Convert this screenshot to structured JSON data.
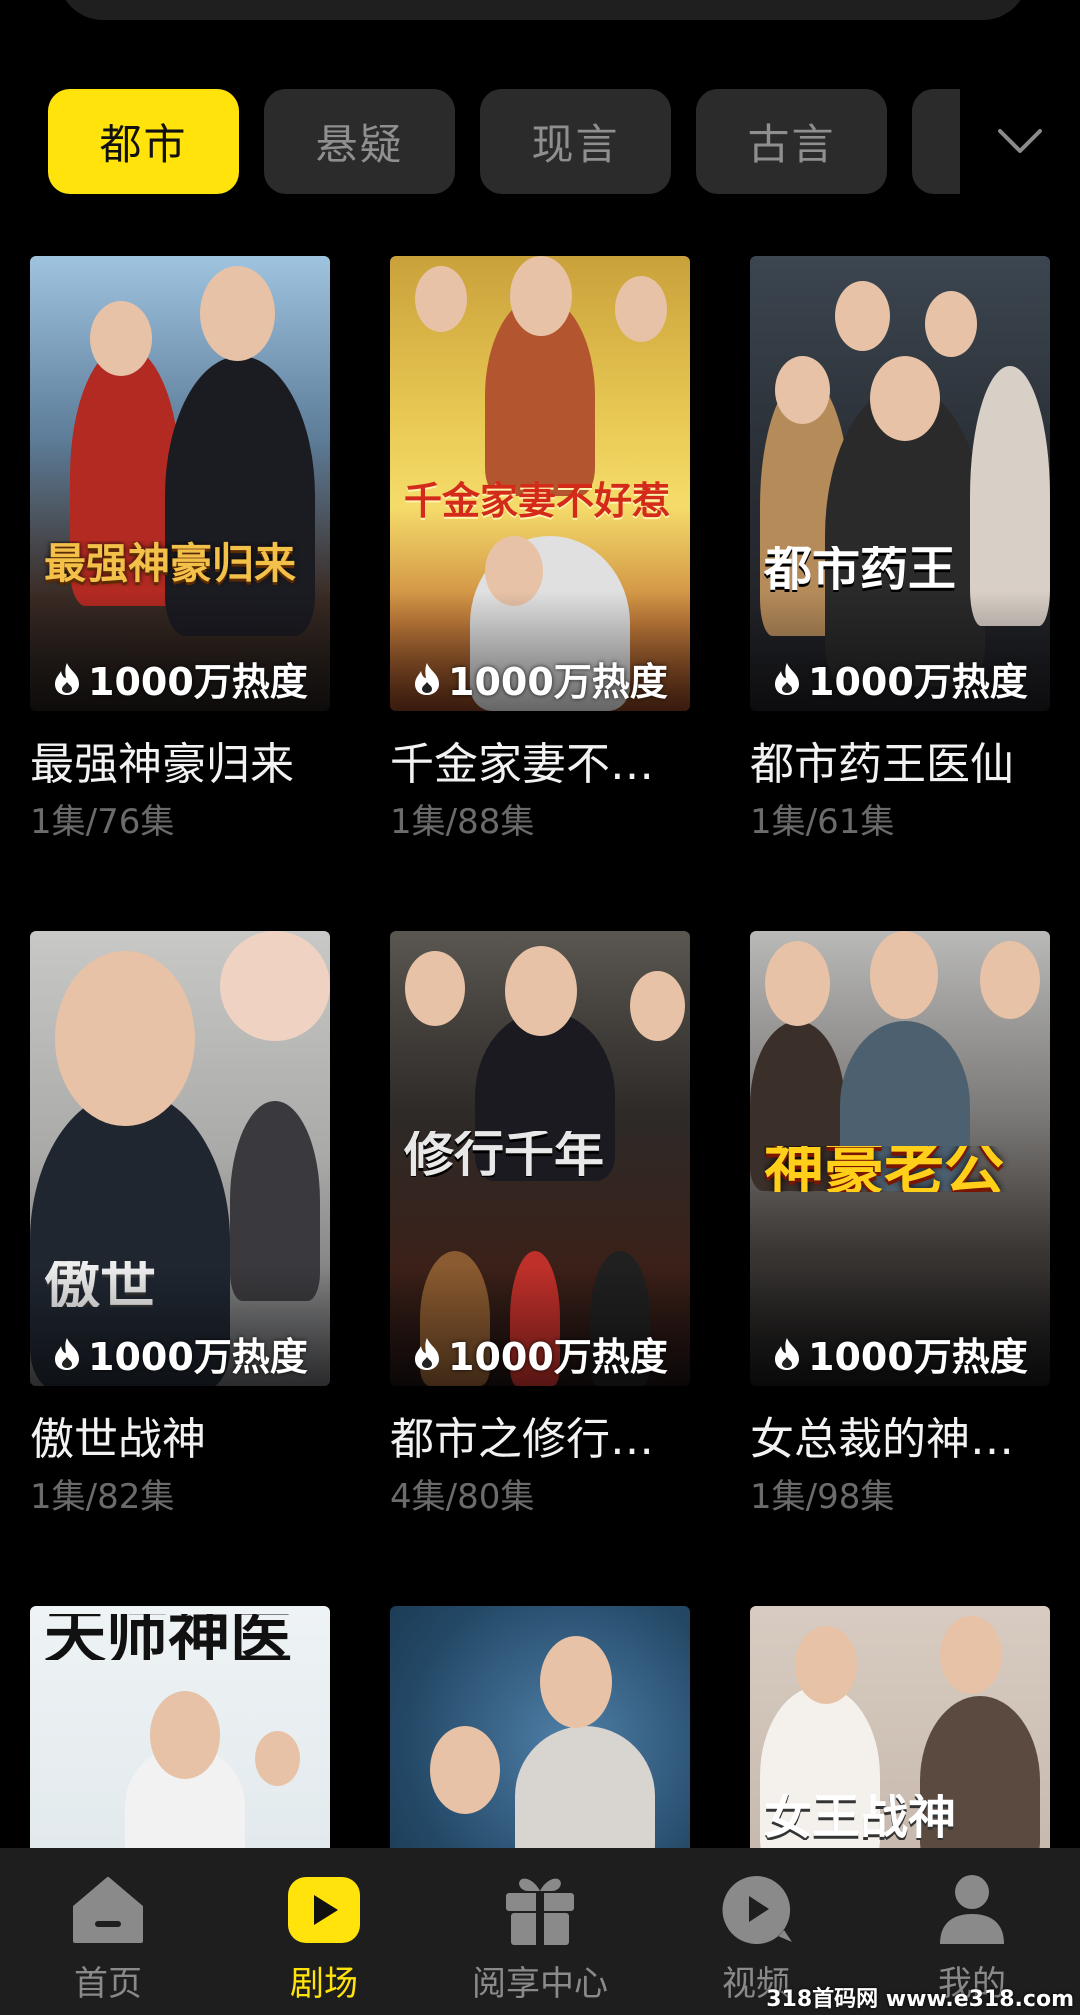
{
  "categories": {
    "items": [
      "都市",
      "悬疑",
      "现言",
      "古言"
    ],
    "active": "都市"
  },
  "dramas": [
    {
      "title": "最强神豪归来",
      "poster_text": "最强神豪归来",
      "heat": "1000万热度",
      "episodes": "1集/76集"
    },
    {
      "title": "千金家妻不…",
      "poster_text": "千金家妻不好惹",
      "heat": "1000万热度",
      "episodes": "1集/88集"
    },
    {
      "title": "都市药王医仙",
      "poster_text": "都市药王",
      "heat": "1000万热度",
      "episodes": "1集/61集"
    },
    {
      "title": "傲世战神",
      "poster_text": "傲世",
      "heat": "1000万热度",
      "episodes": "1集/82集"
    },
    {
      "title": "都市之修行…",
      "poster_text": "修行千年",
      "heat": "1000万热度",
      "episodes": "4集/80集"
    },
    {
      "title": "女总裁的神…",
      "poster_text": "神豪老公",
      "heat": "1000万热度",
      "episodes": "1集/98集"
    },
    {
      "poster_text": "天师神医"
    },
    {
      "poster_text": ""
    },
    {
      "poster_text": "女王战神"
    }
  ],
  "bottom_nav": {
    "items": [
      {
        "label": "首页",
        "icon": "home-icon"
      },
      {
        "label": "剧场",
        "icon": "play-icon"
      },
      {
        "label": "阅享中心",
        "icon": "gift-icon"
      },
      {
        "label": "视频",
        "icon": "video-icon"
      },
      {
        "label": "我的",
        "icon": "user-icon"
      }
    ],
    "active": "剧场"
  },
  "watermark": "318首码网 www.e318.com",
  "colors": {
    "accent": "#ffe30b",
    "background": "#000000",
    "tab_bg": "#2b2b2b",
    "nav_bg": "#1e1e1e"
  }
}
